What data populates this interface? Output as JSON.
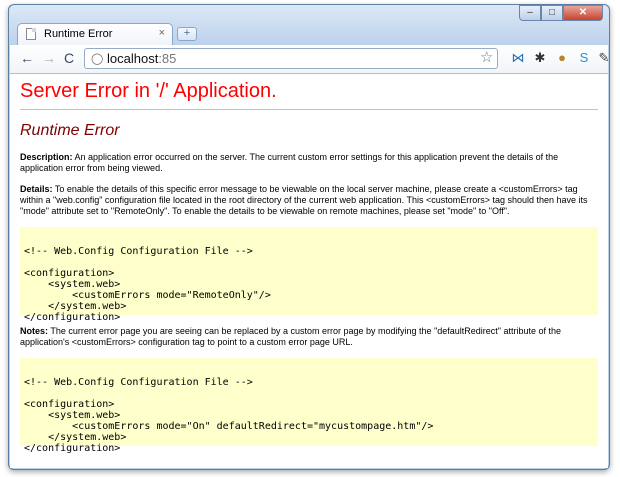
{
  "browser": {
    "tab_title": "Runtime Error",
    "tab_close": "×",
    "new_tab": "+",
    "controls": {
      "minimize": "–",
      "maximize": "□",
      "close": "✕"
    },
    "nav": {
      "back": "←",
      "forward": "→",
      "reload": "C"
    },
    "url_host": "localhost",
    "url_port": ":85"
  },
  "page": {
    "title": "Server Error in '/' Application.",
    "subtitle": "Runtime Error",
    "description": {
      "label": "Description:",
      "text": " An application error occurred on the server. The current custom error settings for this application prevent the details of the application error from being viewed."
    },
    "details": {
      "label": "Details:",
      "text": " To enable the details of this specific error message to be viewable on the local server machine, please create a <customErrors> tag within a \"web.config\" configuration file located in the root directory of the current web application. This <customErrors> tag should then have its \"mode\" attribute set to \"RemoteOnly\". To enable the details to be viewable on remote machines, please set \"mode\" to \"Off\"."
    },
    "code1": "\n<!-- Web.Config Configuration File -->\n\n<configuration>\n    <system.web>\n        <customErrors mode=\"RemoteOnly\"/>\n    </system.web>\n</configuration>",
    "notes": {
      "label": "Notes:",
      "text": " The current error page you are seeing can be replaced by a custom error page by modifying the \"defaultRedirect\" attribute of the application's <customErrors> configuration tag to point to a custom error page URL."
    },
    "code2": "\n<!-- Web.Config Configuration File -->\n\n<configuration>\n    <system.web>\n        <customErrors mode=\"On\" defaultRedirect=\"mycustompage.htm\"/>\n    </system.web>\n</configuration>"
  }
}
